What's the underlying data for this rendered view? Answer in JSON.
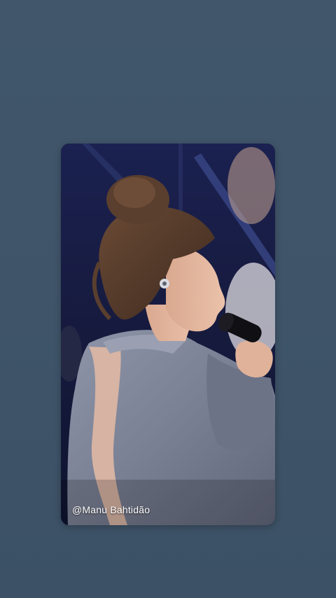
{
  "story": {
    "background_color": "#3f5469",
    "media": {
      "credit_text": "@Manu Bahtidão",
      "icons": {
        "microphone": "microphone-icon",
        "earpiece": "in-ear-monitor-icon"
      }
    }
  }
}
